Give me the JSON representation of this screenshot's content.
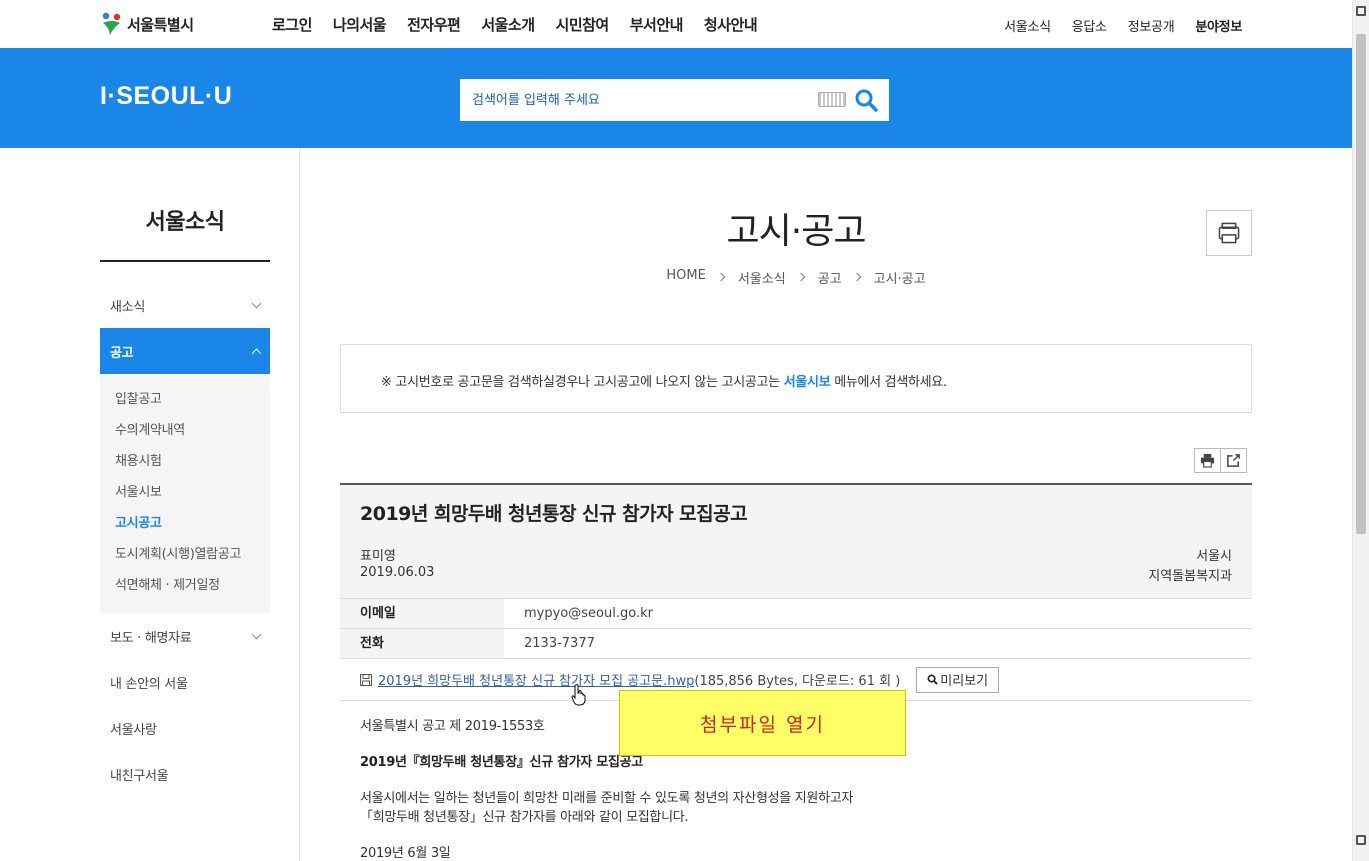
{
  "brand": {
    "logo_text": "서울특별시",
    "iseoul": "I·SEOUL·U"
  },
  "gnb": [
    "로그인",
    "나의서울",
    "전자우편",
    "서울소개",
    "시민참여",
    "부서안내",
    "청사안내"
  ],
  "util": [
    "서울소식",
    "응답소",
    "정보공개",
    "분야정보"
  ],
  "search": {
    "placeholder": "검색어를 입력해 주세요"
  },
  "sidebar": {
    "title": "서울소식",
    "items": [
      {
        "label": "새소식"
      },
      {
        "label": "공고"
      },
      {
        "label": "보도 · 해명자료"
      },
      {
        "label": "내 손안의 서울"
      },
      {
        "label": "서울사랑"
      },
      {
        "label": "내친구서울"
      }
    ],
    "sub": [
      "입찰공고",
      "수의계약내역",
      "채용시험",
      "서울시보",
      "고시공고",
      "도시계획(시행)열람공고",
      "석면해체 · 제거일정"
    ]
  },
  "page": {
    "title": "고시·공고",
    "breadcrumb": [
      "HOME",
      "서울소식",
      "공고",
      "고시·공고"
    ]
  },
  "notice": {
    "pre": "※ 고시번호로 공고문을 검색하실경우나 고시공고에 나오지 않는 고시공고는 ",
    "link": "서울시보",
    "post": " 메뉴에서 검색하세요."
  },
  "article": {
    "title": "2019년 희망두배 청년통장 신규 참가자 모집공고",
    "writer": "표미영",
    "date": "2019.06.03",
    "org1": "서울시",
    "org2": "지역돌봄복지과",
    "email_label": "이메일",
    "email": "mypyo@seoul.go.kr",
    "phone_label": "전화",
    "phone": "2133-7377",
    "file_name": "2019년 희망두배 청년통장 신규 참가자 모집 공고문.hwp",
    "file_meta": " (185,856 Bytes, 다운로드: 61 회 )",
    "preview_label": "미리보기",
    "body": {
      "line1": "서울특별시 공고 제 2019-1553호",
      "line2": "2019년『희망두배 청년통장』신규 참가자 모집공고",
      "line3a": "서울시에서는 일하는 청년들이 희망찬 미래를 준비할 수 있도록 청년의 자산형성을 지원하고자",
      "line3b": "「희망두배 청년통장」신규 참가자를 아래와 같이 모집합니다.",
      "line4": "2019년 6월 3일"
    }
  },
  "tooltip": "첨부파일 열기",
  "colors": {
    "primary": "#1a86e8",
    "tooltip_bg": "#ffff66",
    "tooltip_text": "#d62020"
  }
}
